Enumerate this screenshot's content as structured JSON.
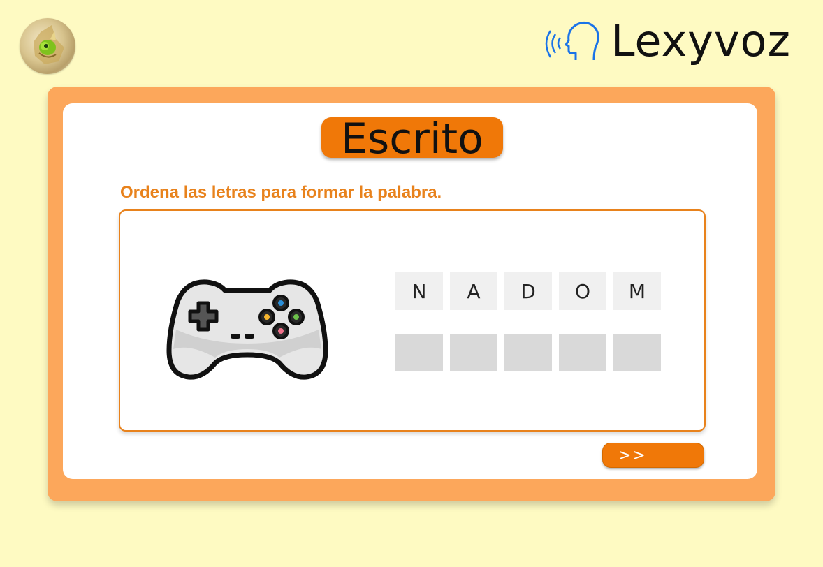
{
  "header": {
    "avatar_icon": "chameleon-avatar-icon",
    "brand": {
      "name": "Lexyvoz",
      "icon": "speaking-head-icon"
    }
  },
  "card": {
    "title": "Escrito",
    "instruction": "Ordena las letras para formar la palabra.",
    "image_icon": "gamepad-icon",
    "letters": [
      "N",
      "A",
      "D",
      "O",
      "M"
    ],
    "answer_slots": 5,
    "next_button": ">>"
  },
  "colors": {
    "background": "#fefac2",
    "outer_frame": "#fca75b",
    "accent": "#f07808",
    "instruction_text": "#e8821c",
    "letter_tile": "#f0f0f0",
    "answer_slot": "#d9d9d9"
  }
}
